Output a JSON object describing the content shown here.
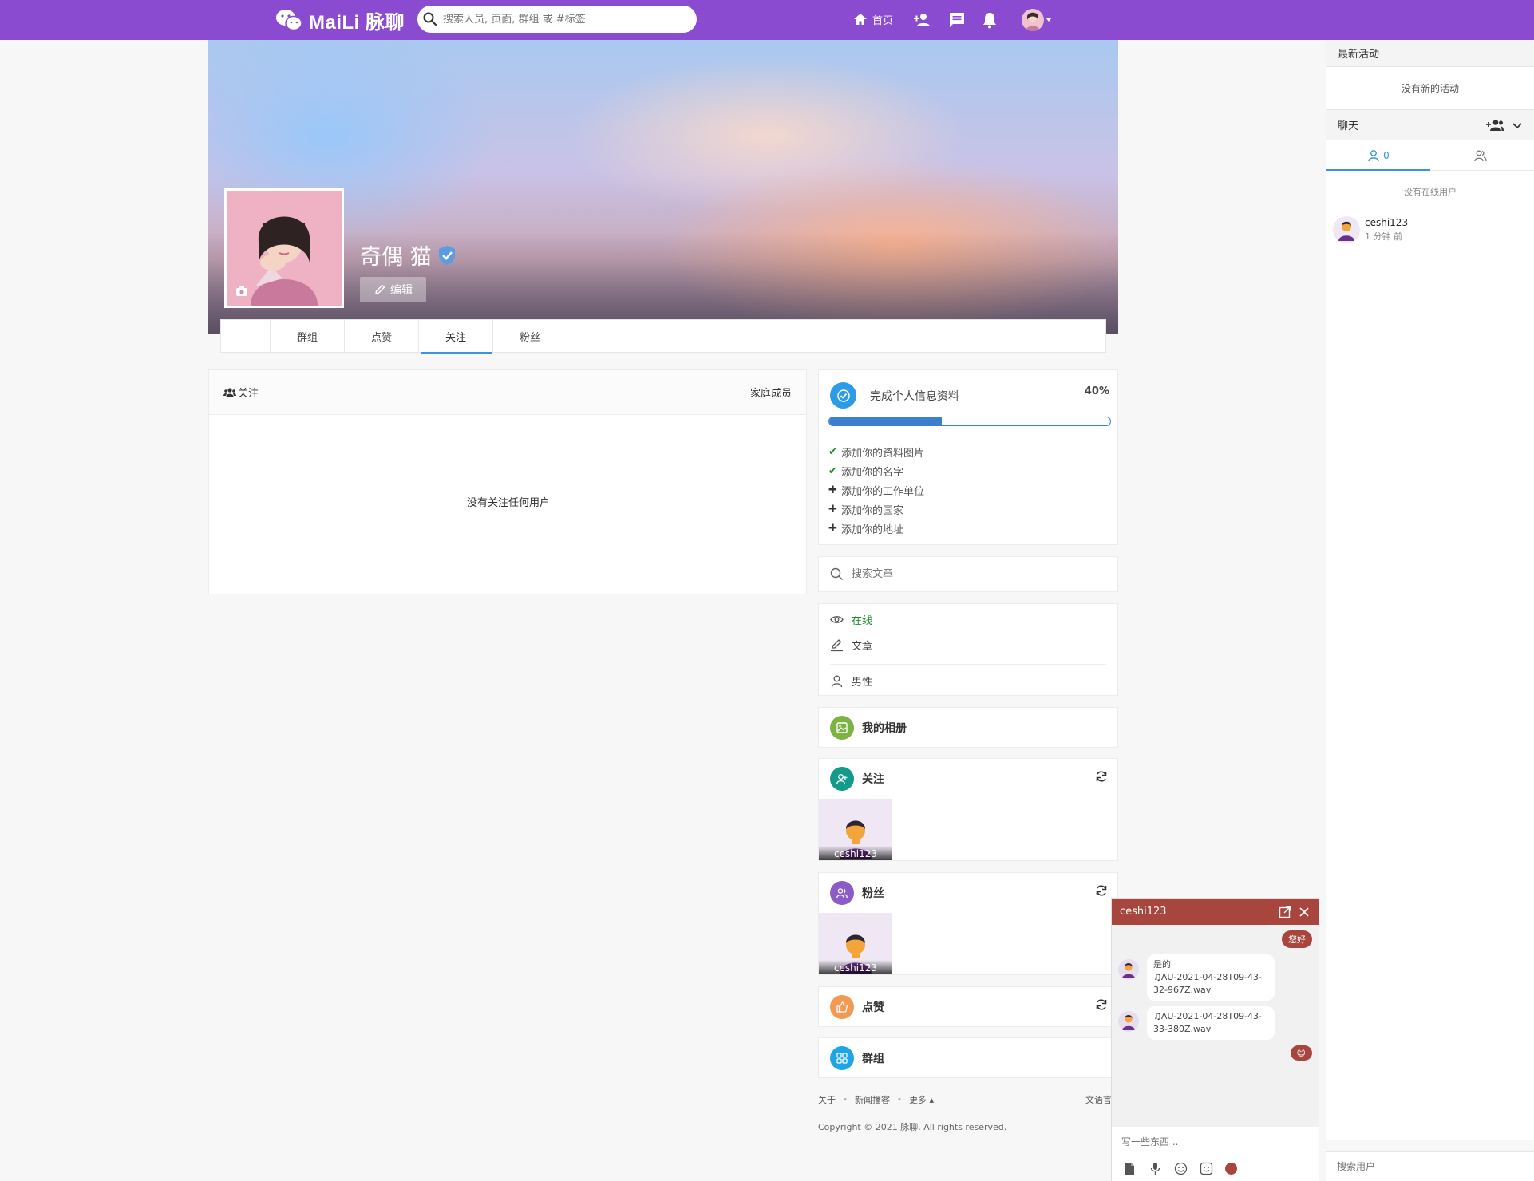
{
  "brand": {
    "name": "MaiLi 脉聊"
  },
  "topbar": {
    "search_placeholder": "搜索人员, 页面, 群组 或 #标签",
    "home_label": "首页",
    "icons": [
      "add-user-icon",
      "messages-icon",
      "bell-icon"
    ]
  },
  "colors": {
    "topbar": "#8a4bd0",
    "accent": "#3b93d8",
    "chat": "#a8453d",
    "success": "#1f8a2e"
  },
  "profile": {
    "name": "奇偶 猫",
    "verified": true,
    "edit_label": "编辑",
    "tabs": [
      {
        "label": "群组",
        "active": false
      },
      {
        "label": "点赞",
        "active": false
      },
      {
        "label": "关注",
        "active": true
      },
      {
        "label": "粉丝",
        "active": false
      }
    ]
  },
  "following": {
    "title": "关注",
    "right_label": "家庭成员",
    "empty_text": "没有关注任何用户"
  },
  "completion": {
    "title": "完成个人信息资料",
    "percent_label": "40%",
    "progress": 0.4,
    "items": [
      {
        "mark": "✔",
        "done": true,
        "text": "添加你的资料图片"
      },
      {
        "mark": "✔",
        "done": true,
        "text": "添加你的名字"
      },
      {
        "mark": "✚",
        "done": false,
        "text": "添加你的工作单位"
      },
      {
        "mark": "✚",
        "done": false,
        "text": "添加你的国家"
      },
      {
        "mark": "✚",
        "done": false,
        "text": "添加你的地址"
      }
    ]
  },
  "post_search": {
    "placeholder": "搜索文章"
  },
  "info": {
    "status": "在线",
    "posts": "文章",
    "gender": "男性"
  },
  "sections": {
    "albums": "我的相册",
    "following": "关注",
    "followers": "粉丝",
    "likes": "点赞",
    "groups": "群组",
    "follow_user": "ceshi123",
    "follower_user": "ceshi123"
  },
  "footer": {
    "about": "关于",
    "blog": "新闻播客",
    "more": "更多",
    "language": "语言",
    "copyright": "Copyright © 2021 脉聊. All rights reserved."
  },
  "sidebar": {
    "activity_title": "最新活动",
    "activity_empty": "没有新的活动",
    "chat_title": "聊天",
    "online_count": "0",
    "no_online": "没有在线用户",
    "user": {
      "name": "ceshi123",
      "time": "1 分钟 前"
    },
    "search_placeholder": "搜索用户"
  },
  "chat": {
    "title": "ceshi123",
    "messages": [
      {
        "dir": "out",
        "text": "您好"
      },
      {
        "dir": "in",
        "text": "是的",
        "file": "AU-2021-04-28T09-43-32-967Z.wav"
      },
      {
        "dir": "in",
        "file": "AU-2021-04-28T09-43-33-380Z.wav"
      },
      {
        "dir": "out",
        "text": "😄"
      }
    ],
    "input_placeholder": "写一些东西 .."
  }
}
